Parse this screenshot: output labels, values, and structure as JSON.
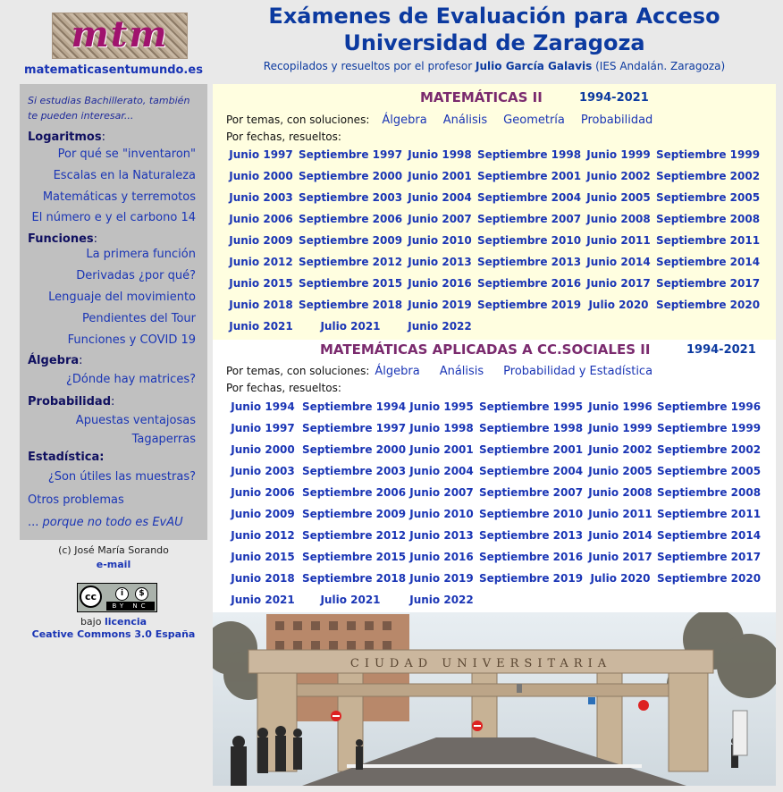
{
  "header": {
    "logo_text": "mtm",
    "site_url": "matematicasentumundo.es",
    "title_line1": "Exámenes de Evaluación para Acceso",
    "title_line2": "Universidad de Zaragoza",
    "subtitle_pre": "Recopilados y resueltos por el profesor ",
    "subtitle_name": "Julio García Galavis",
    "subtitle_post": " (IES Andalán. Zaragoza)"
  },
  "sidebar": {
    "intro": "Si estudias Bachillerato, también te pueden interesar...",
    "logaritmos": {
      "title": "Logaritmos",
      "colon": ":",
      "links": [
        "Por qué se \"inventaron\"",
        "Escalas en la Naturaleza",
        "Matemáticas y terremotos",
        "El número e y el carbono 14"
      ]
    },
    "funciones": {
      "title": "Funciones",
      "colon": ":",
      "links": [
        "La primera función",
        "Derivadas ¿por qué?",
        "Lenguaje del movimiento",
        "Pendientes del Tour",
        "Funciones y COVID 19"
      ]
    },
    "algebra": {
      "title": "Álgebra",
      "colon": ":",
      "links": [
        "¿Dónde hay matrices?"
      ]
    },
    "probabilidad": {
      "title": "Probabilidad",
      "colon": ":",
      "links": [
        "Apuestas ventajosas",
        "Tagaperras"
      ]
    },
    "estadistica": {
      "title": "Estadística:",
      "links": [
        "¿Son útiles las muestras?"
      ]
    },
    "otros": "Otros problemas",
    "evau_prefix": "... ",
    "evau_italic": "porque no todo es EvAU"
  },
  "footer": {
    "copyright": "(c) José María Sorando",
    "email": "e-mail",
    "cc_label": "cc",
    "cc_by": "BY",
    "cc_nc": "NC",
    "license_pre": "bajo ",
    "license_link": "licencia",
    "license_name": "Ceative Commons 3.0 España"
  },
  "panel1": {
    "title": "MATEMÁTICAS II",
    "years": "1994-2021",
    "topics_label": "Por temas, con soluciones:",
    "topics": [
      "Álgebra",
      "Análisis",
      "Geometría",
      "Probabilidad"
    ],
    "dates_label": "Por fechas, resueltos:",
    "rows": [
      [
        "Junio 1997",
        "Septiembre 1997",
        "Junio 1998",
        "Septiembre 1998",
        "Junio 1999",
        "Septiembre 1999"
      ],
      [
        "Junio 2000",
        "Septiembre 2000",
        "Junio 2001",
        "Septiembre 2001",
        "Junio 2002",
        "Septiembre 2002"
      ],
      [
        "Junio 2003",
        "Septiembre 2003",
        "Junio 2004",
        "Septiembre 2004",
        "Junio 2005",
        "Septiembre 2005"
      ],
      [
        "Junio 2006",
        "Septiembre 2006",
        "Junio 2007",
        "Septiembre 2007",
        "Junio 2008",
        "Septiembre 2008"
      ],
      [
        "Junio 2009",
        "Septiembre 2009",
        "Junio 2010",
        "Septiembre 2010",
        "Junio 2011",
        "Septiembre 2011"
      ],
      [
        "Junio 2012",
        "Septiembre 2012",
        "Junio 2013",
        "Septiembre 2013",
        "Junio 2014",
        "Septiembre 2014"
      ],
      [
        "Junio 2015",
        "Septiembre 2015",
        "Junio 2016",
        "Septiembre 2016",
        "Junio 2017",
        "Septiembre 2017"
      ],
      [
        "Junio 2018",
        "Septiembre 2018",
        "Junio 2019",
        "Septiembre 2019",
        "Julio 2020",
        "Septiembre 2020"
      ],
      [
        "Junio 2021",
        "Julio 2021",
        "Junio 2022"
      ]
    ]
  },
  "panel2": {
    "title": "MATEMÁTICAS APLICADAS A CC.SOCIALES II",
    "years": "1994-2021",
    "topics_label": "Por temas, con soluciones:",
    "topics": [
      "Álgebra",
      "Análisis",
      "Probabilidad y Estadística"
    ],
    "dates_label": "Por fechas, resueltos:",
    "rows": [
      [
        "Junio 1994",
        "Septiembre 1994",
        "Junio 1995",
        "Septiembre 1995",
        "Junio 1996",
        "Septiembre 1996"
      ],
      [
        "Junio 1997",
        "Septiembre 1997",
        "Junio 1998",
        "Septiembre 1998",
        "Junio 1999",
        "Septiembre 1999"
      ],
      [
        "Junio 2000",
        "Septiembre 2000",
        "Junio 2001",
        "Septiembre 2001",
        "Junio 2002",
        "Septiembre 2002"
      ],
      [
        "Junio 2003",
        "Septiembre 2003",
        "Junio 2004",
        "Septiembre 2004",
        "Junio 2005",
        "Septiembre 2005"
      ],
      [
        "Junio 2006",
        "Septiembre 2006",
        "Junio 2007",
        "Septiembre 2007",
        "Junio 2008",
        "Septiembre 2008"
      ],
      [
        "Junio 2009",
        "Septiembre 2009",
        "Junio 2010",
        "Septiembre 2010",
        "Junio 2011",
        "Septiembre 2011"
      ],
      [
        "Junio 2012",
        "Septiembre 2012",
        "Junio 2013",
        "Septiembre 2013",
        "Junio 2014",
        "Septiembre 2014"
      ],
      [
        "Junio 2015",
        "Septiembre 2015",
        "Junio 2016",
        "Septiembre 2016",
        "Junio 2017",
        "Septiembre 2017"
      ],
      [
        "Junio 2018",
        "Septiembre 2018",
        "Junio 2019",
        "Septiembre 2019",
        "Julio 2020",
        "Septiembre 2020"
      ],
      [
        "Junio 2021",
        "Julio 2021",
        "Junio 2022"
      ]
    ]
  },
  "photo": {
    "arch_text": "CIUDAD UNIVERSITARIA"
  },
  "colors": {
    "link": "#1a35b5",
    "title": "#0c3aa0",
    "panel_title": "#7a2a6e",
    "panel1_bg": "#fffee0",
    "sidebar_bg": "#c0c0c0"
  }
}
